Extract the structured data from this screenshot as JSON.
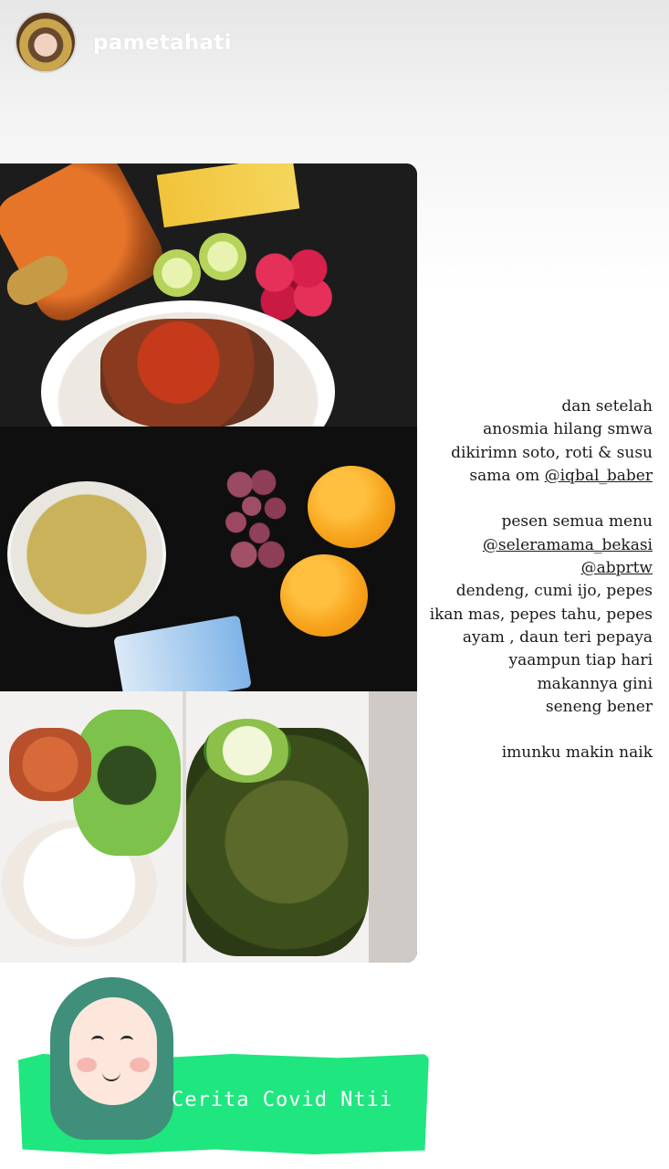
{
  "header": {
    "username": "pametahati"
  },
  "caption": {
    "lines": [
      "dan setelah",
      "anosmia hilang smwa",
      "dikirimn soto, roti & susu",
      "sama om ",
      "",
      "pesen semua menu",
      "",
      "",
      "dendeng, cumi ijo, pepes",
      "ikan mas, pepes tahu, pepes",
      "ayam , daun teri pepaya",
      "yaampun tiap hari",
      "makannya gini",
      "seneng bener",
      "",
      "imunku makin naik"
    ],
    "mentions": {
      "iqbal": "@iqbal_baber",
      "seleramama": "@seleramama_bekasi",
      "abprtw": "@abprtw"
    }
  },
  "sticker": {
    "label": "Cerita Covid Ntii"
  },
  "colors": {
    "sticker_green": "#1fe67f",
    "hijab": "#3f8f7a"
  }
}
